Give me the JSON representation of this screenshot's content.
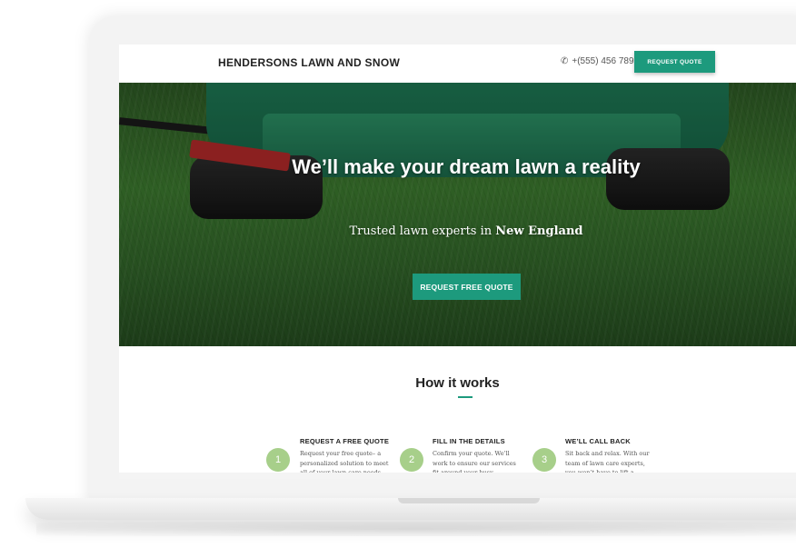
{
  "nav": {
    "brand": "HENDERSONS LAWN AND SNOW",
    "phone": "+(555) 456 789",
    "cta": "REQUEST QUOTE"
  },
  "hero": {
    "headline": "We’ll make your dream lawn a reality",
    "subtitle_prefix": "Trusted lawn experts in",
    "subtitle_highlight": "New England",
    "cta": "REQUEST FREE QUOTE"
  },
  "how": {
    "title": "How it works",
    "steps": [
      {
        "number": "1",
        "title": "REQUEST A FREE QUOTE",
        "text": "Request your free quote– a personalized solution to meet all of your lawn care needs."
      },
      {
        "number": "2",
        "title": "FILL IN THE DETAILS",
        "text": "Confirm your quote. We’ll work to ensure our services fit around your busy schedule."
      },
      {
        "number": "3",
        "title": "WE’LL CALL BACK",
        "text": "Sit back and relax. With our team of lawn care experts, you won’t have to lift a finger."
      }
    ]
  },
  "colors": {
    "accent": "#1d9a7d",
    "step_circle": "#a7cf8a"
  },
  "icons": {
    "phone": "phone-icon"
  }
}
